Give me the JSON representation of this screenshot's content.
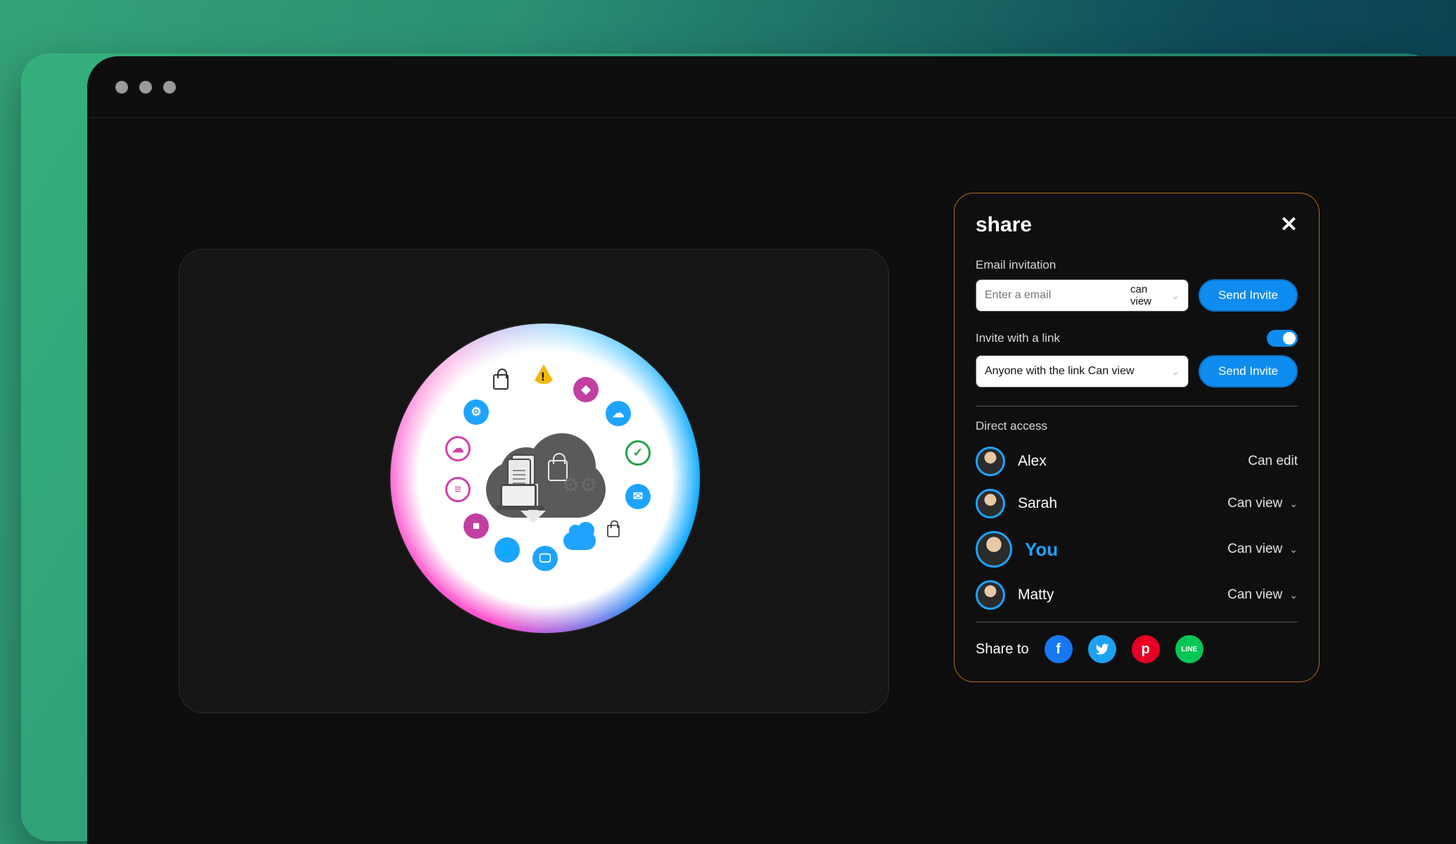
{
  "share": {
    "title": "share",
    "email_section_label": "Email invitation",
    "email_placeholder": "Enter a email",
    "email_permission": "can view",
    "send_invite_label": "Send Invite",
    "link_section_label": "Invite with a link",
    "link_toggle_on": true,
    "link_permission_text": "Anyone with the link Can view",
    "direct_access_label": "Direct access",
    "people": [
      {
        "name": "Alex",
        "permission": "Can edit",
        "show_chevron": false,
        "is_you": false
      },
      {
        "name": "Sarah",
        "permission": "Can view",
        "show_chevron": true,
        "is_you": false
      },
      {
        "name": "You",
        "permission": "Can view",
        "show_chevron": true,
        "is_you": true
      },
      {
        "name": "Matty",
        "permission": "Can view",
        "show_chevron": true,
        "is_you": false
      }
    ],
    "share_to_label": "Share to",
    "social": {
      "facebook": "f",
      "twitter": "t",
      "pinterest": "p",
      "line": "LINE"
    }
  }
}
